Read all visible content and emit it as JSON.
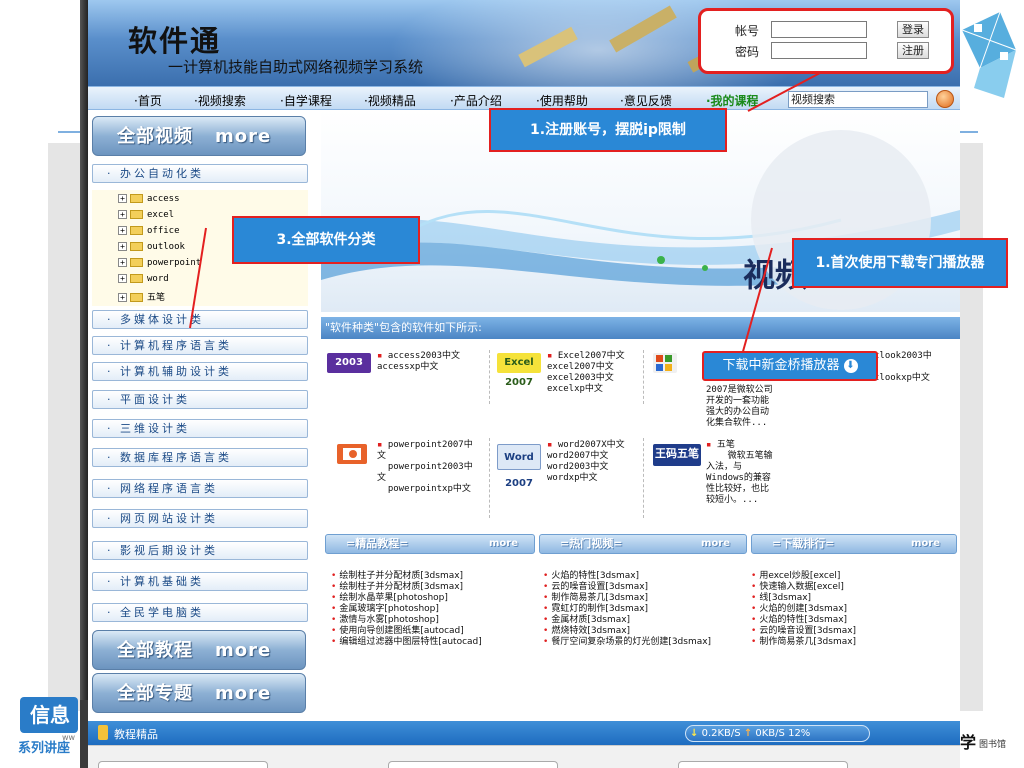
{
  "site": {
    "title": "软件通",
    "subtitle": "一计算机技能自助式网络视频学习系统"
  },
  "login": {
    "account_label": "帐号",
    "password_label": "密码",
    "account_value": "",
    "password_value": "",
    "login_button": "登录",
    "register_button": "注册"
  },
  "nav": {
    "items": [
      "·首页",
      "·视频搜索",
      "·自学课程",
      "·视频精品",
      "·产品介绍",
      "·使用帮助",
      "·意见反馈",
      "·我的课程"
    ],
    "search_value": "视频搜索",
    "active_color": "#1a8a1a"
  },
  "sidebar": {
    "video_header": "全部视频",
    "video_more": "more",
    "office_category": "· 办公自动化类",
    "tree": [
      "access",
      "excel",
      "office",
      "outlook",
      "powerpoint",
      "word",
      "五笔"
    ],
    "categories": [
      "· 多媒体设计类",
      "· 计算机程序语言类",
      "· 计算机辅助设计类",
      "· 平面设计类",
      "· 三维设计类",
      "· 数据库程序语言类",
      "· 网络程序语言类",
      "· 网页网站设计类",
      "· 影视后期设计类",
      "· 计算机基础类",
      "· 全民学电脑类"
    ],
    "tutorial_header": "全部教程",
    "tutorial_more": "more",
    "topic_header": "全部专题",
    "topic_more": "more"
  },
  "hero": {
    "title_text": "视频"
  },
  "category_panel": {
    "header": "\"软件种类\"包含的软件如下所示:",
    "products": [
      {
        "icon": "2003",
        "icon_name": "access-2003-icon",
        "text": "access2003中文\naccessxp中文"
      },
      {
        "icon": "Excel 2007",
        "icon_name": "excel-2007-icon",
        "text": "Excel2007中文\nexcel2007中文\nexcel2003中文\nexcelxp中文"
      },
      {
        "icon": "",
        "icon_name": "office-icon",
        "text": "2007是微软公司\n开发的一套功能\n强大的办公自动\n化集合软件..."
      },
      {
        "icon": "",
        "icon_name": "outlook-icon",
        "text": "tlook2003中\n\ntlookxp中文"
      },
      {
        "icon": "",
        "icon_name": "powerpoint-icon",
        "text": "powerpoint2007中\n文\n  powerpoint2003中\n文\n  powerpointxp中文"
      },
      {
        "icon": "Word 2007",
        "icon_name": "word-2007-icon",
        "text": "word2007X中文\nword2007中文\nword2003中文\nwordxp中文"
      },
      {
        "icon": "王码五笔",
        "icon_name": "wubi-icon",
        "text": "五笔\n    微软五笔输\n入法，与\nWindows的兼容\n性比较好，也比\n较短小。..."
      }
    ]
  },
  "tabs": [
    {
      "title": "=精品教程=",
      "more": "more",
      "items": [
        "绘制柱子并分配材质[3dsmax]",
        "绘制柱子并分配材质[3dsmax]",
        "绘制水晶苹果[photoshop]",
        "金属玻璃字[photoshop]",
        "激情与水雾[photoshop]",
        "使用向导创建图纸集[autocad]",
        "编辑组过滤器中图层特性[autocad]"
      ]
    },
    {
      "title": "=热门视频=",
      "more": "more",
      "items": [
        "火焰的特性[3dsmax]",
        "云的噪音设置[3dsmax]",
        "制作简易茶几[3dsmax]",
        "霓虹灯的制作[3dsmax]",
        "金属材质[3dsmax]",
        "燃烧特效[3dsmax]",
        "餐厅空间复杂场景的灯光创建[3dsmax]"
      ]
    },
    {
      "title": "=下载排行=",
      "more": "more",
      "items": [
        "用excel炒股[excel]",
        "快速输入数据[excel]",
        "线[3dsmax]",
        "火焰的创建[3dsmax]",
        "火焰的特性[3dsmax]",
        "云的噪音设置[3dsmax]",
        "制作简易茶几[3dsmax]"
      ]
    }
  ],
  "status": {
    "label": "教程精品",
    "down_speed": "0.2KB/S",
    "up_speed": "0KB/S",
    "percent": "12%"
  },
  "annotations": {
    "register": "1.注册账号，摆脱ip限制",
    "categories": "3.全部软件分类",
    "first_use": "1.首次使用下载专门播放器",
    "download_button": "下载中新金桥播放器"
  },
  "slide": {
    "badge": "信息",
    "badge_sub": "ww",
    "series": "系列讲座",
    "logo": "学",
    "logo_sub": "图书馆"
  }
}
